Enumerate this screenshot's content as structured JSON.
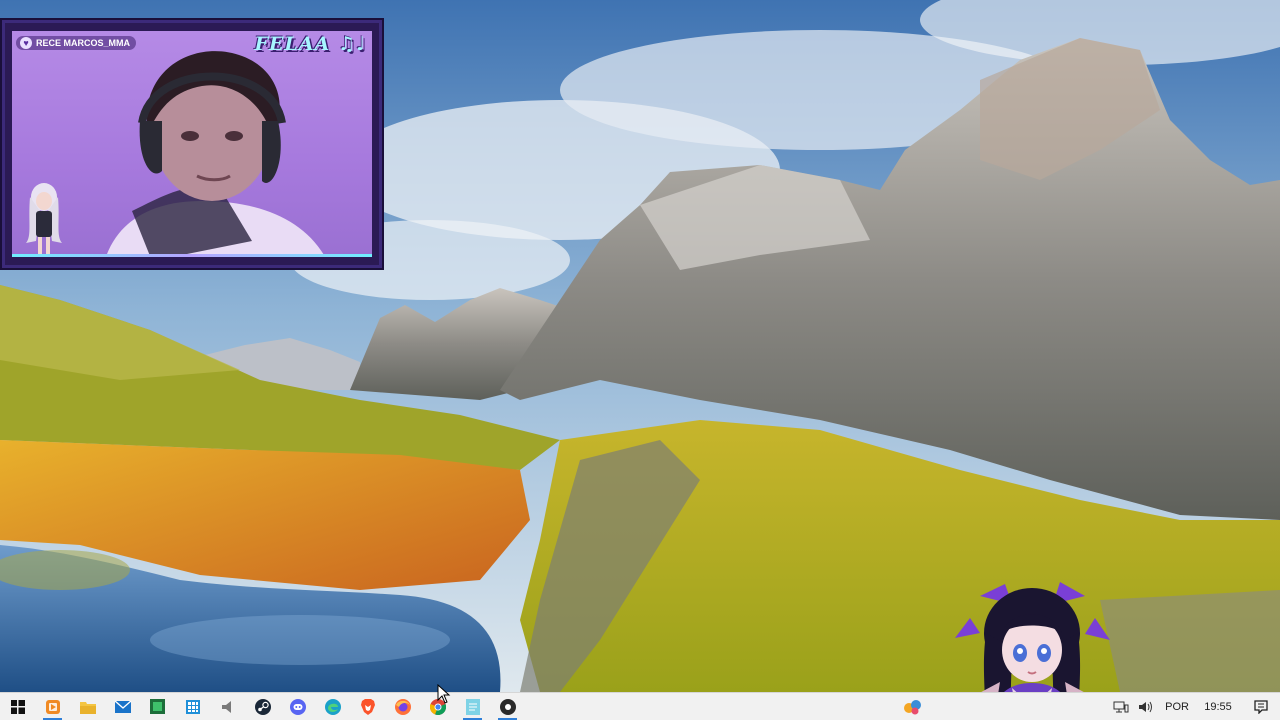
{
  "webcam": {
    "handle": "RECE MARCOS_MMA",
    "brand": "FELAA ♫♩",
    "border_color": "#3c2a7a",
    "glow_color": "#a7f6ff"
  },
  "taskbar": {
    "apps": [
      {
        "name": "start",
        "icon": "windows-logo-icon",
        "color": "#111111"
      },
      {
        "name": "obs",
        "icon": "orange-app-icon",
        "color": "#f08a24",
        "active": true
      },
      {
        "name": "explorer",
        "icon": "folder-icon",
        "color": "#f4c542"
      },
      {
        "name": "mail",
        "icon": "mail-icon",
        "color": "#1a73c9"
      },
      {
        "name": "app-green",
        "icon": "green-app-icon",
        "color": "#2e9e4f"
      },
      {
        "name": "calculator",
        "icon": "grid-app-icon",
        "color": "#1f8fd8"
      },
      {
        "name": "volume-mixer",
        "icon": "speaker-icon",
        "color": "#7a7a7a"
      },
      {
        "name": "steam",
        "icon": "steam-icon",
        "color": "#1b2838"
      },
      {
        "name": "discord",
        "icon": "discord-icon",
        "color": "#5865f2"
      },
      {
        "name": "edge",
        "icon": "edge-icon",
        "color": "#1ba1c9"
      },
      {
        "name": "brave",
        "icon": "brave-icon",
        "color": "#fb542b"
      },
      {
        "name": "firefox",
        "icon": "firefox-icon",
        "color": "#ff7139"
      },
      {
        "name": "chrome",
        "icon": "chrome-icon",
        "color": "#4285f4"
      },
      {
        "name": "notepad",
        "icon": "notepad-icon",
        "color": "#7fd3e6"
      },
      {
        "name": "streaming-app",
        "icon": "dark-circle-app-icon",
        "color": "#2a2a2a"
      }
    ],
    "tray": {
      "language": "POR",
      "time": "19:55"
    }
  }
}
